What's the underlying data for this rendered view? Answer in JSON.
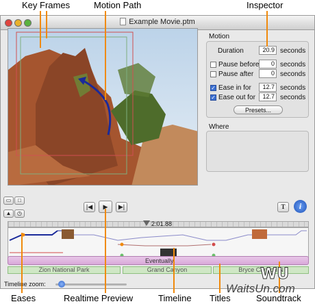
{
  "callouts": {
    "key_frames": "Key Frames",
    "motion_path": "Motion Path",
    "inspector": "Inspector",
    "eases": "Eases",
    "realtime_preview": "Realtime Preview",
    "timeline": "Timeline",
    "titles": "Titles",
    "soundtrack": "Soundtrack"
  },
  "window": {
    "title": "Example Movie.ptm"
  },
  "inspector": {
    "motion_heading": "Motion",
    "duration_label": "Duration",
    "duration_value": "20.9",
    "pause_before_label": "Pause before",
    "pause_before_value": "0",
    "pause_after_label": "Pause after",
    "pause_after_value": "0",
    "ease_in_label": "Ease in for",
    "ease_in_value": "12.7",
    "ease_out_label": "Ease out for",
    "ease_out_value": "12.7",
    "unit": "seconds",
    "presets_label": "Presets...",
    "where_heading": "Where"
  },
  "transport": {
    "time": "2:01.88",
    "inspector_text_button": "T",
    "info_button": "i"
  },
  "timeline": {
    "title_track": "Eventually",
    "sound_clips": [
      "Zion National Park",
      "Grand Canyon",
      "Bryce Canyon N"
    ],
    "zoom_label": "Timeline zoom:"
  },
  "watermark": "WaitsUn.com"
}
